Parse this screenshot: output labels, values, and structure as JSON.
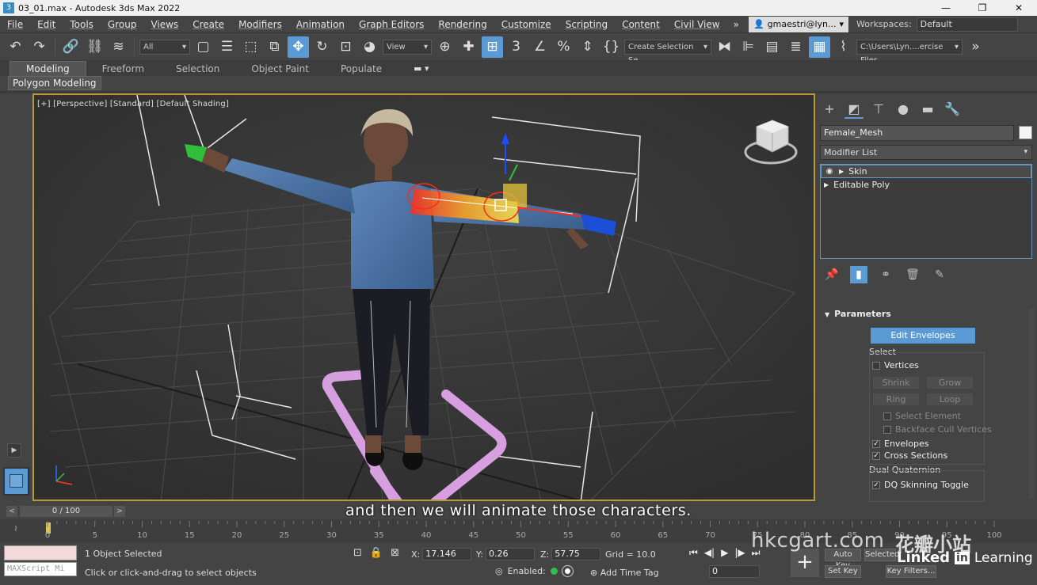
{
  "window": {
    "title": "03_01.max - Autodesk 3ds Max 2022",
    "app_icon": "3ds-max-icon",
    "controls": [
      "minimize",
      "maximize",
      "close"
    ]
  },
  "menubar": {
    "items": [
      "File",
      "Edit",
      "Tools",
      "Group",
      "Views",
      "Create",
      "Modifiers",
      "Animation",
      "Graph Editors",
      "Rendering",
      "Customize",
      "Scripting",
      "Content",
      "Civil View"
    ],
    "more": "»",
    "user": "gmaestri@lyn...",
    "workspaces_label": "Workspaces:",
    "workspace": "Default"
  },
  "toolbar": {
    "selection_filter": "All",
    "ref_coord": "View",
    "named_selection": "Create Selection Se",
    "project_path": "C:\\Users\\Lyn....ercise Files"
  },
  "ribbon": {
    "tabs": [
      "Modeling",
      "Freeform",
      "Selection",
      "Object Paint",
      "Populate"
    ],
    "active_tab": "Modeling",
    "panel": "Polygon Modeling"
  },
  "viewport": {
    "label": "[+] [Perspective] [Standard] [Default Shading]",
    "border_color": "#b89a34",
    "subtitle": "and then we will animate those characters."
  },
  "command_panel": {
    "tabs": [
      "create-icon",
      "modify-icon",
      "hierarchy-icon",
      "motion-icon",
      "display-icon",
      "utilities-icon"
    ],
    "object_name": "Female_Mesh",
    "modifier_list": "Modifier List",
    "stack": [
      {
        "label": "Skin",
        "selected": true
      },
      {
        "label": "Editable Poly",
        "selected": false
      }
    ],
    "rollout": "Parameters",
    "edit_envelopes": "Edit Envelopes",
    "select_label": "Select",
    "vertices": "Vertices",
    "shrink": "Shrink",
    "grow": "Grow",
    "ring": "Ring",
    "loop": "Loop",
    "select_element": "Select Element",
    "backface_cull": "Backface Cull Vertices",
    "envelopes": "Envelopes",
    "cross_sections": "Cross Sections",
    "dual_quaternion": "Dual Quaternion",
    "dq_toggle": "DQ Skinning Toggle"
  },
  "timeline": {
    "frame_display": "0 / 100",
    "ticks": [
      "0",
      "5",
      "10",
      "15",
      "20",
      "25",
      "30",
      "35",
      "40",
      "45",
      "50",
      "55",
      "60",
      "65",
      "70",
      "75",
      "80",
      "85",
      "90",
      "95",
      "100"
    ]
  },
  "status": {
    "selection": "1 Object Selected",
    "prompt": "Click or click-and-drag to select objects",
    "maxscript": "MAXScript Mi",
    "x_label": "X:",
    "x": "17.146",
    "y_label": "Y:",
    "y": "0.26",
    "z_label": "Z:",
    "z": "57.75",
    "grid": "Grid = 10.0",
    "enabled": "Enabled:",
    "add_time_tag": "Add Time Tag",
    "frame": "0",
    "auto_key": "Auto Key",
    "selected": "Selected",
    "set_key": "Set Key",
    "key_filters": "Key Filters..."
  },
  "watermarks": {
    "site": "hkcgart.com",
    "cjk": "花瓣小站",
    "linkedin": "Linked",
    "in": "in",
    "learning": "Learning"
  }
}
